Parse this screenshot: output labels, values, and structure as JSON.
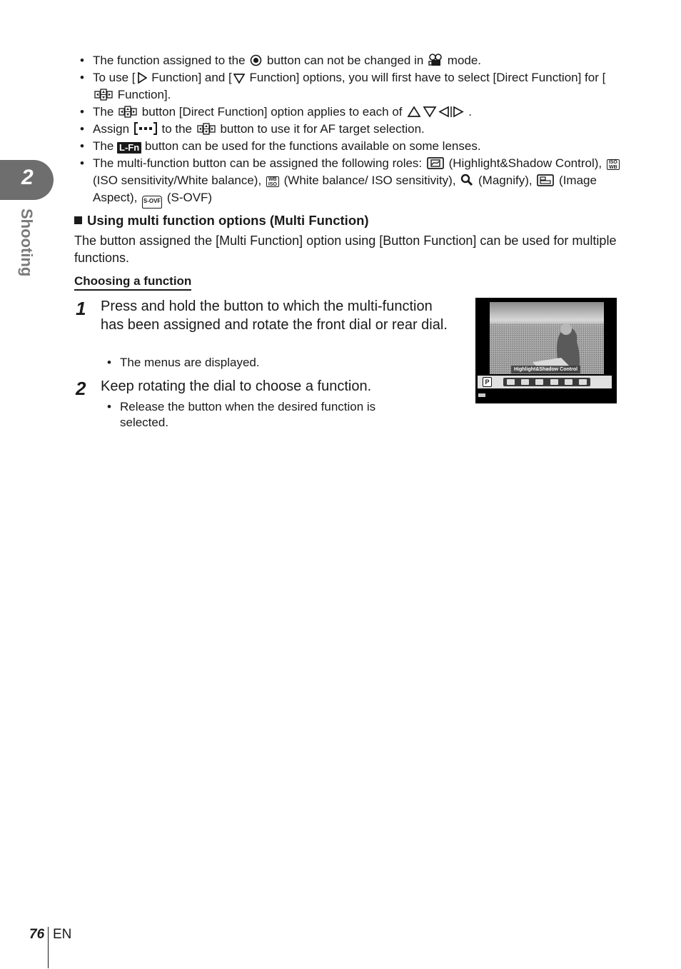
{
  "chapter": {
    "number": "2",
    "label": "Shooting"
  },
  "bullets": [
    {
      "parts": [
        "The function assigned to the ",
        " button can not be changed in ",
        " mode."
      ],
      "icons": [
        "record-button-icon",
        "movie-mode-icon"
      ]
    },
    {
      "parts": [
        "To use [",
        " Function] and [",
        " Function] options, you will first have to select [Direct Function] for [",
        " Function]."
      ],
      "icons": [
        "right-arrow-icon",
        "down-arrow-icon",
        "cross-pad-icon"
      ]
    },
    {
      "parts": [
        "The ",
        " button [Direct Function] option applies to each of ",
        "."
      ],
      "icons": [
        "cross-pad-icon",
        "arrow-keys-icon"
      ]
    },
    {
      "parts": [
        "Assign ",
        " to the ",
        " button to use it for AF target selection."
      ],
      "icons": [
        "af-target-icon",
        "cross-pad-icon"
      ]
    },
    {
      "parts": [
        "The ",
        " button can be used for the functions available on some lenses."
      ],
      "icons": [
        "lfn-icon"
      ],
      "lfn_label": "L-Fn"
    },
    {
      "parts": [
        "The multi-function button can be assigned the following roles: ",
        " (Highlight&Shadow Control), ",
        " (ISO sensitivity/White balance), ",
        " (White balance/ ISO sensitivity), ",
        " (Magnify), ",
        " (Image Aspect), ",
        " (S-OVF)"
      ],
      "icons": [
        "highlight-shadow-icon",
        "iso-wb-icon",
        "wb-iso-icon",
        "magnify-icon",
        "image-aspect-icon",
        "s-ovf-icon"
      ]
    }
  ],
  "icon_labels": {
    "iso_wb": [
      "ISO",
      "WB"
    ],
    "wb_iso": [
      "WB",
      "ISO"
    ],
    "s_ovf": "S-OVF",
    "arrows": "△▽◁▷"
  },
  "section": {
    "heading": "Using multi function options (Multi Function)",
    "body": "The button assigned the [Multi Function] option using [Button Function] can be used for multiple functions.",
    "subheading": "Choosing a function"
  },
  "steps": [
    {
      "number": "1",
      "text": "Press and hold the button to which the multi-function has been assigned and rotate the front dial or rear dial.",
      "notes": [
        "The menus are displayed."
      ]
    },
    {
      "number": "2",
      "text": "Keep rotating the dial to choose a function.",
      "notes": [
        "Release the button when the desired function is selected."
      ]
    }
  ],
  "camera_screen": {
    "mode": "P",
    "selected_label": "Highlight&Shadow Control",
    "menu_icons": [
      "highlight-shadow",
      "iso-wb",
      "wb-iso",
      "magnify",
      "image-aspect",
      "s-ovf"
    ]
  },
  "footer": {
    "page": "76",
    "lang": "EN"
  }
}
